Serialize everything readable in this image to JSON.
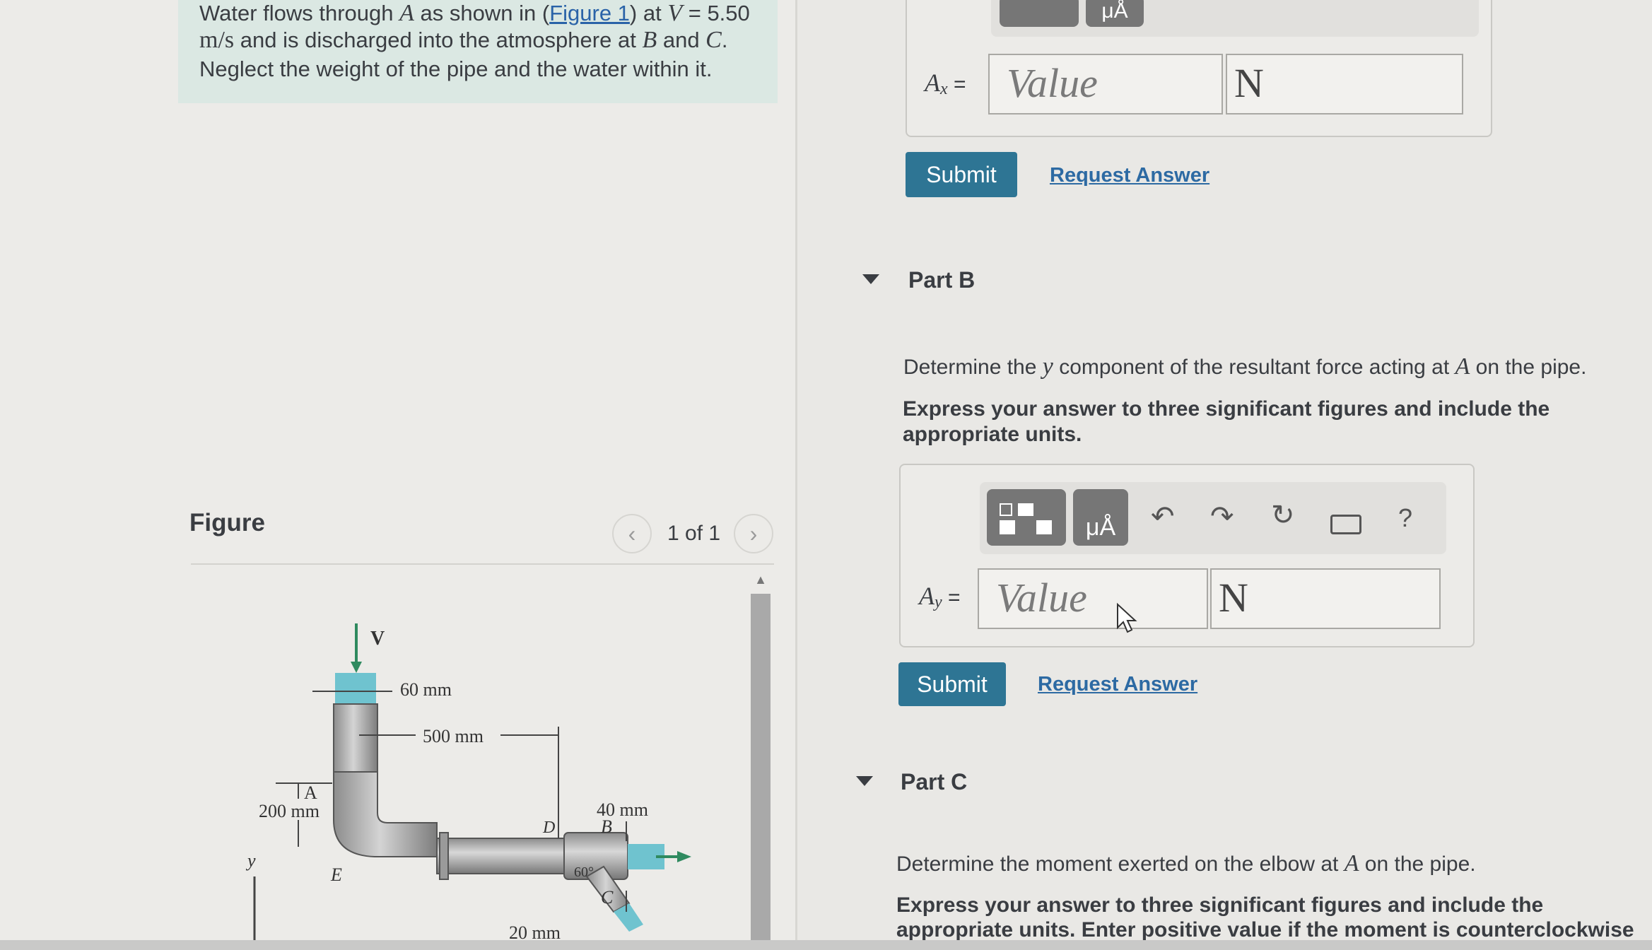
{
  "problem": {
    "line1_pre": "Water flows through ",
    "line1_A": "A",
    "line1_mid": " as shown in (",
    "line1_link": "Figure 1",
    "line1_post": ") at ",
    "line1_V": "V",
    "line1_eq": " = 5.50",
    "line2_unit": "m/s",
    "line2_mid": " and is discharged into the atmosphere at ",
    "line2_B": "B",
    "line2_and": " and ",
    "line2_C": "C",
    "line2_dot": ".",
    "line3": "Neglect the weight of the pipe and the water within it."
  },
  "figure": {
    "heading": "Figure",
    "pager": "1 of 1",
    "prev_glyph": "‹",
    "next_glyph": "›",
    "labels": {
      "V": "V",
      "d60": "60 mm",
      "d500": "500 mm",
      "A": "A",
      "d200": "200 mm",
      "y": "y",
      "E": "E",
      "D": "D",
      "d40": "40 mm",
      "B": "B",
      "angle": "60°",
      "C": "C",
      "d20": "20 mm"
    }
  },
  "part_a": {
    "var_main": "A",
    "var_sub": "x",
    "eq": " =",
    "value_placeholder": "Value",
    "unit_value": "N",
    "submit": "Submit",
    "request": "Request Answer",
    "tool_units": "μÅ"
  },
  "part_b": {
    "title": "Part B",
    "question_pre": "Determine the ",
    "question_var": "y",
    "question_mid": " component of the resultant force acting at ",
    "question_A": "A",
    "question_post": " on the pipe.",
    "instruction_1": "Express your answer to three significant figures and include the",
    "instruction_2": "appropriate units.",
    "tool_units": "μÅ",
    "tool_help": "?",
    "var_main": "A",
    "var_sub": "y",
    "eq": " =",
    "value_placeholder": "Value",
    "unit_value": "N",
    "submit": "Submit",
    "request": "Request Answer"
  },
  "part_c": {
    "title": "Part C",
    "question_pre": "Determine the moment exerted on the elbow at ",
    "question_A": "A",
    "question_post": " on the pipe.",
    "instruction_1": "Express your answer to three significant figures and include the",
    "instruction_2": "appropriate units. Enter positive value if the moment is counterclockwise"
  },
  "colors": {
    "submit": "#2e7594",
    "link": "#2d6aa3",
    "problem_bg": "#dbe8e3",
    "water": "#6fc3cf",
    "arrow": "#2f8a5f"
  }
}
